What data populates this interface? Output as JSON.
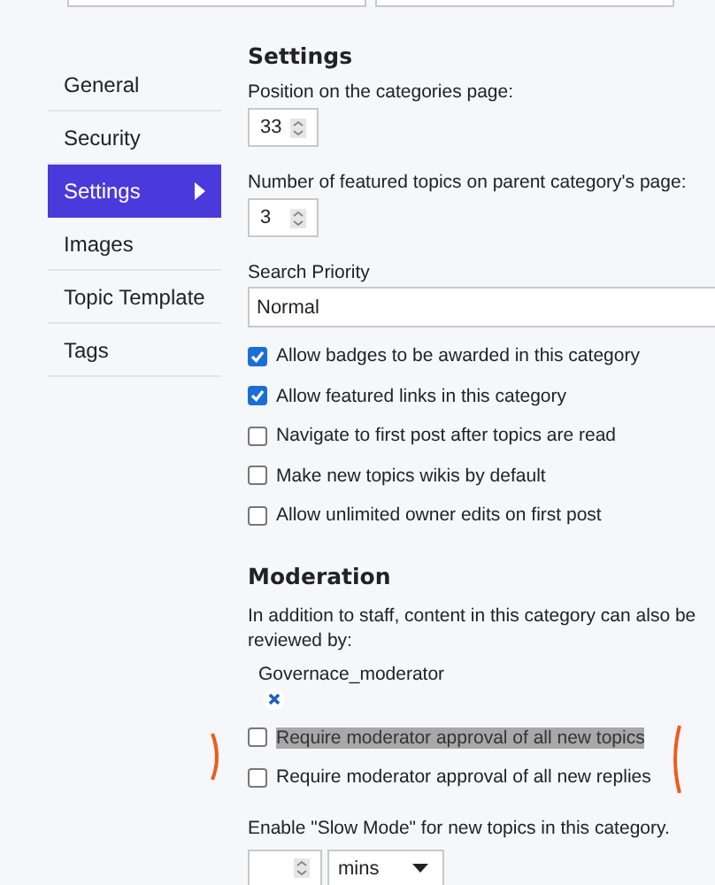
{
  "nav": [
    {
      "label": "General",
      "selected": false
    },
    {
      "label": "Security",
      "selected": false
    },
    {
      "label": "Settings",
      "selected": true
    },
    {
      "label": "Images",
      "selected": false
    },
    {
      "label": "Topic Template",
      "selected": false
    },
    {
      "label": "Tags",
      "selected": false
    }
  ],
  "settings": {
    "title": "Settings",
    "position": {
      "label": "Position on the categories page:",
      "value": "33"
    },
    "featured": {
      "label": "Number of featured topics on parent category's page:",
      "value": "3"
    },
    "search_priority": {
      "label": "Search Priority",
      "value": "Normal"
    },
    "options": [
      {
        "label": "Allow badges to be awarded in this category",
        "checked": true
      },
      {
        "label": "Allow featured links in this category",
        "checked": true
      },
      {
        "label": "Navigate to first post after topics are read",
        "checked": false
      },
      {
        "label": "Make new topics wikis by default",
        "checked": false
      },
      {
        "label": "Allow unlimited owner edits on first post",
        "checked": false
      }
    ]
  },
  "moderation": {
    "title": "Moderation",
    "description": "In addition to staff, content in this category can also be reviewed by:",
    "reviewer_group": "Governace_moderator",
    "options": [
      {
        "label": "Require moderator approval of all new topics",
        "checked": false,
        "highlighted": true
      },
      {
        "label": "Require moderator approval of all new replies",
        "checked": false,
        "highlighted": false
      }
    ],
    "slow_mode": {
      "label": "Enable \"Slow Mode\" for new topics in this category.",
      "unit": "mins"
    }
  }
}
